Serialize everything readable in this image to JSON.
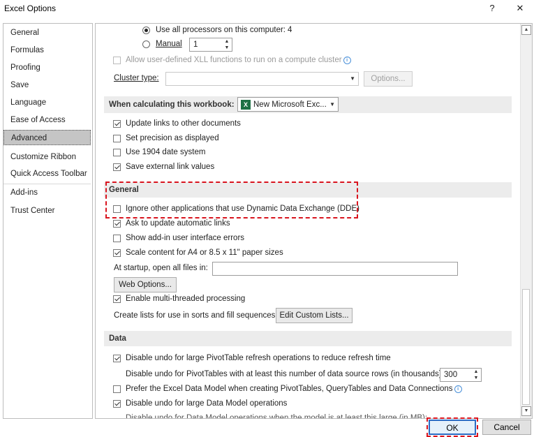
{
  "window": {
    "title": "Excel Options",
    "help_glyph": "?",
    "close_glyph": "✕"
  },
  "nav": {
    "items": [
      {
        "label": "General"
      },
      {
        "label": "Formulas"
      },
      {
        "label": "Proofing"
      },
      {
        "label": "Save"
      },
      {
        "label": "Language"
      },
      {
        "label": "Ease of Access"
      },
      {
        "label": "Advanced"
      },
      {
        "label": "Customize Ribbon"
      },
      {
        "label": "Quick Access Toolbar"
      },
      {
        "label": "Add-ins"
      },
      {
        "label": "Trust Center"
      }
    ]
  },
  "formulas": {
    "all_processors_label": "Use all processors on this computer:",
    "all_processors_count": "4",
    "manual_label": "Manual",
    "manual_value": "1",
    "allow_xll_label": "Allow user-defined XLL functions to run on a compute cluster",
    "cluster_type_label": "Cluster type:",
    "cluster_type_value": "",
    "options_button": "Options..."
  },
  "calc_workbook": {
    "label": "When calculating this workbook:",
    "workbook_value": "New Microsoft Exc...",
    "icon_letter": "X",
    "update_links": "Update links to other documents",
    "set_precision": "Set precision as displayed",
    "date_1904": "Use 1904 date system",
    "save_external": "Save external link values"
  },
  "general": {
    "header": "General",
    "ignore_dde": "Ignore other applications that use Dynamic Data Exchange (DDE)",
    "ask_update": "Ask to update automatic links",
    "show_addin_errors": "Show add-in user interface errors",
    "scale_content": "Scale content for A4 or 8.5 x 11\" paper sizes",
    "startup_label": "At startup, open all files in:",
    "startup_value": "",
    "web_options_button": "Web Options...",
    "multithread": "Enable multi-threaded processing",
    "custom_lists_label": "Create lists for use in sorts and fill sequences:",
    "custom_lists_button": "Edit Custom Lists..."
  },
  "data": {
    "header": "Data",
    "disable_undo_pivot": "Disable undo for large PivotTable refresh operations to reduce refresh time",
    "disable_undo_rows_label": "Disable undo for PivotTables with at least this number of data source rows (in thousands):",
    "disable_undo_rows_value": "300",
    "prefer_data_model": "Prefer the Excel Data Model when creating PivotTables, QueryTables and Data Connections",
    "disable_undo_data_model": "Disable undo for large Data Model operations",
    "cutoff_row": "Disable undo for Data Model operations when the model is at least this large (in MB):"
  },
  "footer": {
    "ok": "OK",
    "cancel": "Cancel"
  },
  "colors": {
    "highlight": "#d9141e",
    "excel_green": "#1e7145",
    "selected_nav": "#c5c5c5"
  }
}
